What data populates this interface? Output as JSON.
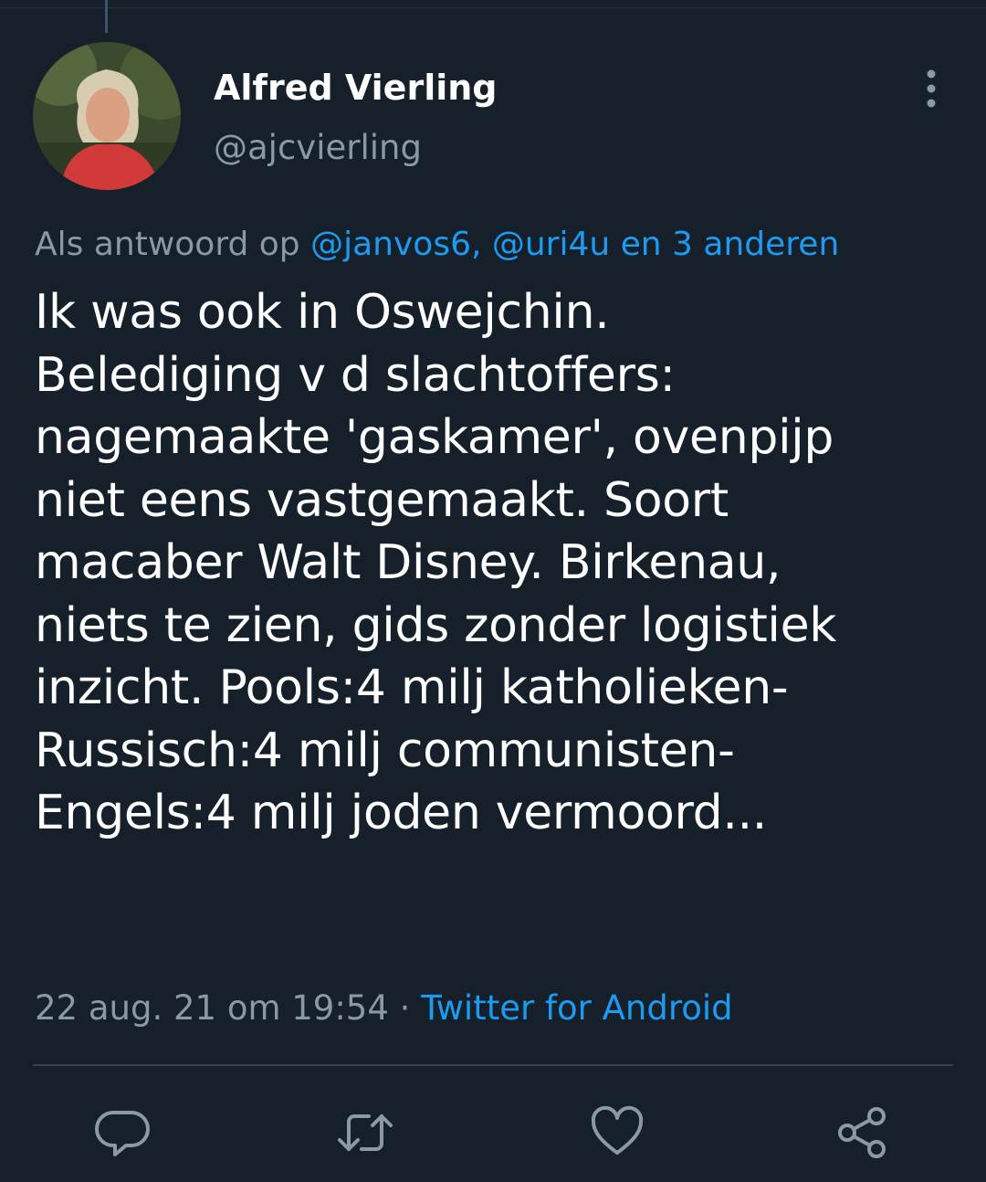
{
  "tweet": {
    "author": {
      "display_name": "Alfred Vierling",
      "handle": "@ajcvierling"
    },
    "reply_to": {
      "prefix": "Als antwoord op ",
      "mentions": "@janvos6, @uri4u en 3 anderen"
    },
    "text": "Ik  was ook in Oswejchin.\nBelediging v d slachtoffers:\nnagemaakte 'gaskamer', ovenpijp\nniet eens vastgemaakt. Soort\nmacaber Walt Disney. Birkenau,\nniets te zien, gids zonder logistiek\ninzicht. Pools:4 milj katholieken-\nRussisch:4 milj communisten-\nEngels:4 milj joden vermoord...",
    "timestamp": "22 aug. 21 om 19:54",
    "separator": " · ",
    "source": "Twitter for Android"
  },
  "icons": {
    "more": "more-vertical-icon",
    "reply": "reply-icon",
    "retweet": "retweet-icon",
    "like": "heart-icon",
    "share": "share-icon"
  },
  "colors": {
    "background": "#15202b",
    "accent": "#1d9bf0",
    "secondary_text": "#8b98a5",
    "divider": "#38444d"
  }
}
